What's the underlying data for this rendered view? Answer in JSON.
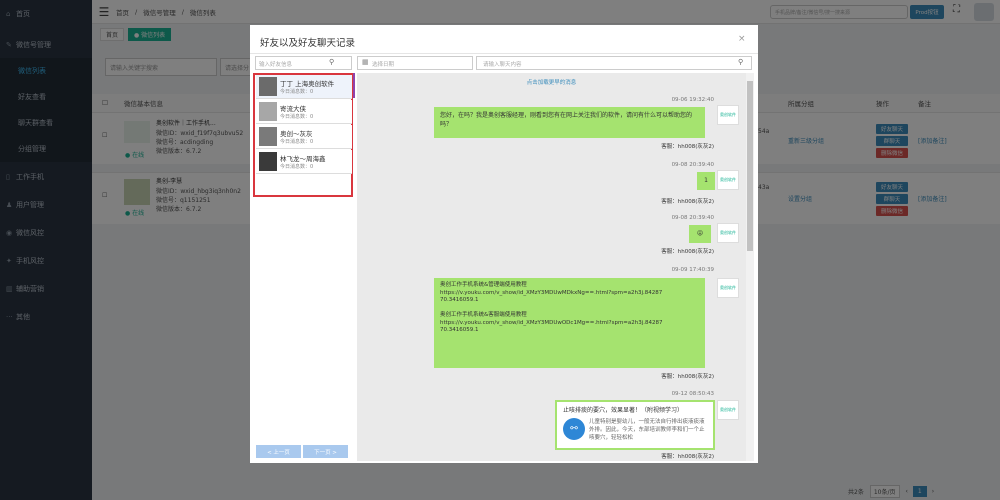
{
  "sidebar": {
    "items": [
      {
        "label": "首页",
        "icon": "home-icon"
      },
      {
        "label": "微信号管理",
        "icon": "wechat-icon"
      },
      {
        "label": "微信列表",
        "sub": true,
        "active": true
      },
      {
        "label": "好友查看",
        "sub": true
      },
      {
        "label": "聊天群查看",
        "sub": true
      },
      {
        "label": "分组管理",
        "sub": true
      },
      {
        "label": "工作手机",
        "icon": "phone-icon"
      },
      {
        "label": "用户管理",
        "icon": "user-icon"
      },
      {
        "label": "微信风控",
        "icon": "shield-icon"
      },
      {
        "label": "手机风控",
        "icon": "phone-shield-icon"
      },
      {
        "label": "辅助营销",
        "icon": "chart-icon"
      },
      {
        "label": "其他",
        "icon": "more-icon"
      }
    ]
  },
  "topbar": {
    "breadcrumb": [
      "首页",
      "微信号管理",
      "微信列表"
    ],
    "search_placeholder": "手机品牌/备注/微信号/搜一搜来源",
    "search_button": "Prod按钮"
  },
  "tabs": [
    {
      "label": "首页"
    },
    {
      "label": "● 微信列表",
      "active": true
    }
  ],
  "background": {
    "search_placeholder": "请输入关键字搜索",
    "search2": "请选择分",
    "headers": {
      "info": "微信基本信息",
      "group": "所属分组",
      "action": "操作",
      "note": "备注"
    },
    "rows": [
      {
        "name": "奥创软件｜工作手机...",
        "id": "微信ID：wxid_f19f7q3ubvu52",
        "account": "微信号：acdingding",
        "version": "微信版本：6.7.2",
        "status": "● 在线",
        "group": "重新三级分组",
        "extra": "54a",
        "actions": [
          "好友聊天",
          "群聊天",
          "删除微信"
        ],
        "note": "[添加备注]"
      },
      {
        "name": "奥创-李慧",
        "id": "微信ID：wxid_hbg3iq3nh0n2",
        "account": "微信号：q1151251",
        "version": "微信版本：6.7.2",
        "status": "● 在线",
        "group": "设置分组",
        "extra": "43a",
        "actions": [
          "好友聊天",
          "群聊天",
          "删除微信"
        ],
        "note": "[添加备注]"
      }
    ]
  },
  "modal": {
    "title": "好友以及好友聊天记录",
    "close": "×",
    "friend_search_placeholder": "输入好友信息",
    "date_placeholder": "选择日期",
    "keyword_placeholder": "请输入聊天内容",
    "friends": [
      {
        "name": "丁丁 上海奥创软件",
        "today": "今日消息数：0"
      },
      {
        "name": "寄流大侠",
        "today": "今日消息数：0"
      },
      {
        "name": "奥创～灰灰",
        "today": "今日消息数：0"
      },
      {
        "name": "林飞龙～周海鑫",
        "today": "今日消息数：0"
      }
    ],
    "prev_page": "< 上一页",
    "next_page": "下一页 >",
    "load_more": "点击加载更早的消息",
    "messages": [
      {
        "time": "09-06 19:32:40",
        "text": "您好，在吗？我是奥创客服经理，刚看到您有在网上关注我们的软件，请问有什么可以帮助您的吗？",
        "sender": "客服：hh008(灰灰2)"
      },
      {
        "time": "09-08 20:39:40",
        "text": "1",
        "sender": "客服：hh008(灰灰2)"
      },
      {
        "time": "09-08 20:39:40",
        "text": "😝",
        "sender": "客服：hh008(灰灰2)"
      },
      {
        "time": "09-09 17:40:39",
        "text": "奥创工作手机系统&管理端使用教程\nhttps://v.youku.com/v_show/id_XMzY3MDUwMDkxNg==.html?spm=a2h3j.84287 70.3416059.1\n\n奥创工作手机系统&客服端使用教程\nhttps://v.youku.com/v_show/id_XMzY3MDUwODc1Mg==.html?spm=a2h3j.84287 70.3416059.1",
        "sender": "客服：hh008(灰灰2)"
      },
      {
        "time": "09-12 08:50:43",
        "title": "止咳排痰的要穴，效果显著！（附视频学习）",
        "desc": "儿童特别是婴幼儿，一般无法自行排出痰液痰液外排。因此，今天，东部培训教师李和们一个止咳要穴，轻轻松松",
        "sender": "客服：hh008(灰灰2)"
      }
    ]
  },
  "pagination": {
    "total": "共2条",
    "per_page": "10条/页",
    "current": "1"
  },
  "colors": {
    "sidebar": "#2a3542",
    "accent": "#1ab394",
    "bubble": "#a5e36f",
    "highlight": "#d9363e"
  }
}
